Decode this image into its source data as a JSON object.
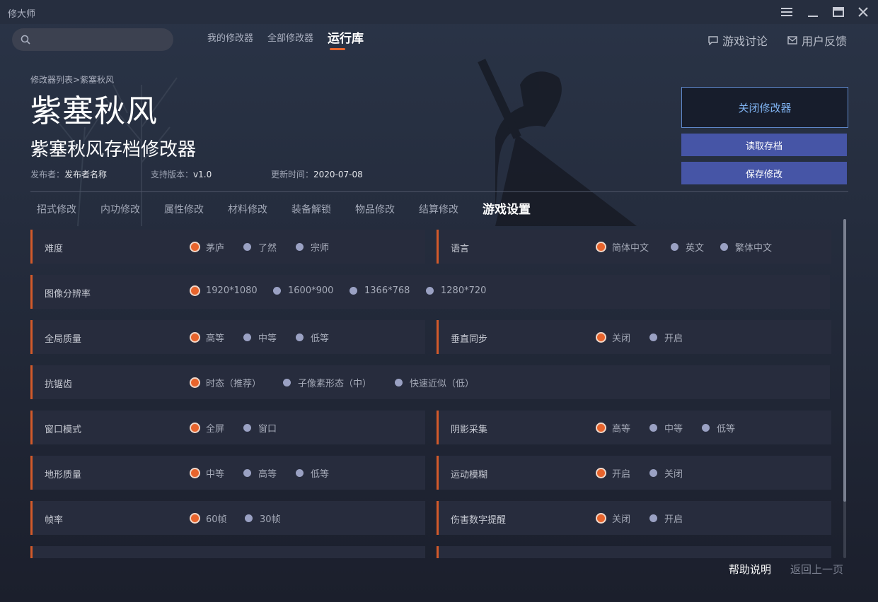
{
  "app": {
    "title": "修大师"
  },
  "window_controls": {
    "menu_icon": "menu-icon",
    "minimize_icon": "minimize-icon",
    "maximize_icon": "maximize-icon",
    "close_icon": "close-icon"
  },
  "search": {
    "placeholder": "",
    "value": ""
  },
  "nav": {
    "tabs": [
      {
        "label": "我的修改器",
        "active": false
      },
      {
        "label": "全部修改器",
        "active": false
      },
      {
        "label": "运行库",
        "active": true
      }
    ]
  },
  "top_links": {
    "discuss": "游戏讨论",
    "feedback": "用户反馈"
  },
  "breadcrumb": "修改器列表>紫塞秋风",
  "game": {
    "title": "紫塞秋风",
    "trainer": "紫塞秋风存档修改器",
    "publisher_label": "发布者：",
    "publisher": "发布者名称",
    "version_label": "支持版本：",
    "version": "v1.0",
    "updated_label": "更新时间：",
    "updated": "2020-07-08"
  },
  "buttons": {
    "close_trainer": "关闭修改器",
    "load_save": "读取存档",
    "save_changes": "保存修改"
  },
  "categories": [
    {
      "label": "招式修改",
      "active": false
    },
    {
      "label": "内功修改",
      "active": false
    },
    {
      "label": "属性修改",
      "active": false
    },
    {
      "label": "材料修改",
      "active": false
    },
    {
      "label": "装备解锁",
      "active": false
    },
    {
      "label": "物品修改",
      "active": false
    },
    {
      "label": "结算修改",
      "active": false
    },
    {
      "label": "游戏设置",
      "active": true
    }
  ],
  "settings": {
    "difficulty": {
      "label": "难度",
      "options": [
        "茅庐",
        "了然",
        "宗师"
      ],
      "selected": 0
    },
    "language": {
      "label": "语言",
      "options": [
        "简体中文",
        "英文",
        "繁体中文"
      ],
      "selected": 0
    },
    "resolution": {
      "label": "图像分辨率",
      "options": [
        "1920*1080",
        "1600*900",
        "1366*768",
        "1280*720"
      ],
      "selected": 0
    },
    "quality": {
      "label": "全局质量",
      "options": [
        "高等",
        "中等",
        "低等"
      ],
      "selected": 0
    },
    "vsync": {
      "label": "垂直同步",
      "options": [
        "关闭",
        "开启"
      ],
      "selected": 0
    },
    "antialias": {
      "label": "抗锯齿",
      "options": [
        "时态（推荐）",
        "子像素形态（中）",
        "快速近似（低）"
      ],
      "selected": 0
    },
    "window_mode": {
      "label": "窗口模式",
      "options": [
        "全屏",
        "窗口"
      ],
      "selected": 0
    },
    "shadow": {
      "label": "阴影采集",
      "options": [
        "高等",
        "中等",
        "低等"
      ],
      "selected": 0
    },
    "terrain": {
      "label": "地形质量",
      "options": [
        "中等",
        "高等",
        "低等"
      ],
      "selected": 0
    },
    "motion_blur": {
      "label": "运动模糊",
      "options": [
        "开启",
        "关闭"
      ],
      "selected": 0
    },
    "framerate": {
      "label": "帧率",
      "options": [
        "60帧",
        "30帧"
      ],
      "selected": 0
    },
    "damage_numbers": {
      "label": "伤害数字提醒",
      "options": [
        "关闭",
        "开启"
      ],
      "selected": 0
    }
  },
  "footer": {
    "help": "帮助说明",
    "back": "返回上一页"
  },
  "colors": {
    "accent": "#e8642c",
    "button": "#4655a6",
    "close_border": "#5f87c9",
    "background": "#1d2231",
    "row": "#272c3d"
  }
}
